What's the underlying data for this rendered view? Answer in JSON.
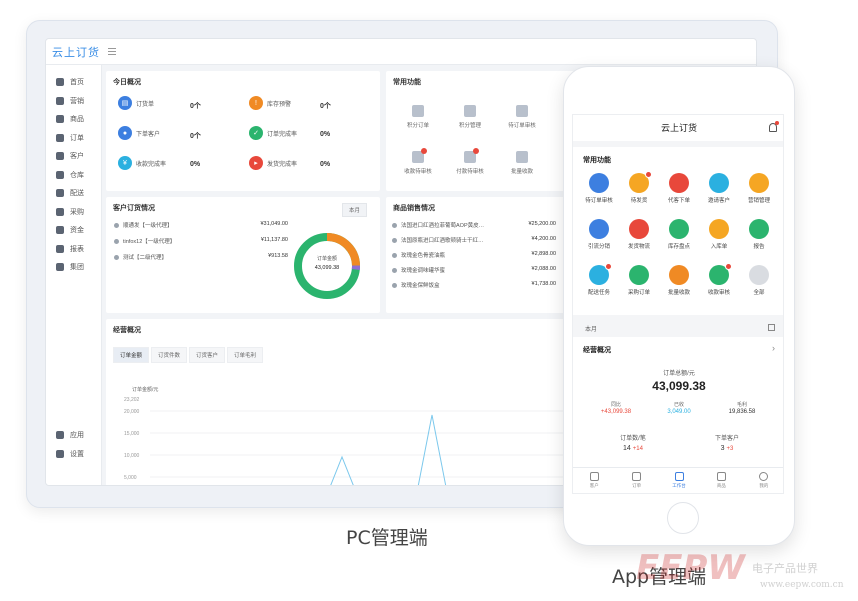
{
  "pc": {
    "brand": "云上订货",
    "sidebar": [
      "首页",
      "营销",
      "商品",
      "订单",
      "客户",
      "仓库",
      "配送",
      "采购",
      "资金",
      "报表",
      "集团"
    ],
    "sidebar_bottom": [
      "应用",
      "设置"
    ],
    "today": {
      "title": "今日概况",
      "stats": [
        {
          "label": "订货单",
          "value": "0个",
          "color": "#3d7fe0"
        },
        {
          "label": "库存预警",
          "value": "0个",
          "color": "#f08a24"
        },
        {
          "label": "下单客户",
          "value": "0个",
          "color": "#3d7fe0"
        },
        {
          "label": "订单完成率",
          "value": "0%",
          "color": "#2bb46e"
        },
        {
          "label": "收款完成率",
          "value": "0%",
          "color": "#2bb0e0"
        },
        {
          "label": "发货完成率",
          "value": "0%",
          "color": "#e8483b"
        }
      ]
    },
    "common": {
      "title": "常用功能",
      "items": [
        "积分订单",
        "积分管理",
        "待订单审核",
        "收款待审核",
        "付款待审核",
        "批量收款"
      ]
    },
    "customer_orders": {
      "title": "客户订货情况",
      "month": "本月",
      "rows": [
        {
          "name": "顺通发【一级代理】",
          "amount": "¥31,049.00"
        },
        {
          "name": "tinfox12【一级代理】",
          "amount": "¥11,137.80"
        },
        {
          "name": "测试【二级代理】",
          "amount": "¥913.58"
        }
      ],
      "donut_label": "订单金额",
      "donut_value": "43,099.38"
    },
    "product_sales": {
      "title": "商品销售情况",
      "rows": [
        {
          "name": "法国进口红酒拉菲葡萄AOP黄皮…",
          "amount": "¥25,200.00"
        },
        {
          "name": "法国原瓶进口红酒歌顿骑士干红…",
          "amount": "¥4,200.00"
        },
        {
          "name": "玫瑰金色骨瓷油瓶",
          "amount": "¥2,898.00"
        },
        {
          "name": "玫瑰金调味罐华蜜",
          "amount": "¥2,088.00"
        },
        {
          "name": "玫瑰金保鲜饭盒",
          "amount": "¥1,738.00"
        }
      ]
    },
    "operations": {
      "title": "经营概况",
      "tabs": [
        "订单金额",
        "订货件数",
        "订货客户",
        "订单毛利"
      ],
      "ylabel": "订单金额/元",
      "yticks": [
        "23,202",
        "20,000",
        "15,000",
        "10,000",
        "5,000"
      ]
    }
  },
  "pc_caption": "PC管理端",
  "app": {
    "title": "云上订货",
    "common_title": "常用功能",
    "apps": [
      {
        "label": "待订单审核",
        "color": "#3d7fe0",
        "badge": false
      },
      {
        "label": "待发货",
        "color": "#f5a623",
        "badge": true
      },
      {
        "label": "代客下单",
        "color": "#e8483b",
        "badge": false
      },
      {
        "label": "邀请客户",
        "color": "#2bb0e0",
        "badge": false
      },
      {
        "label": "营销管理",
        "color": "#f5a623",
        "badge": false
      },
      {
        "label": "引流分销",
        "color": "#3d7fe0",
        "badge": false
      },
      {
        "label": "发货物流",
        "color": "#e8483b",
        "badge": false
      },
      {
        "label": "库存盘点",
        "color": "#2bb46e",
        "badge": false
      },
      {
        "label": "入库单",
        "color": "#f5a623",
        "badge": false
      },
      {
        "label": "报告",
        "color": "#2bb46e",
        "badge": false
      },
      {
        "label": "配送任务",
        "color": "#2bb0e0",
        "badge": true
      },
      {
        "label": "采购订单",
        "color": "#2bb46e",
        "badge": false
      },
      {
        "label": "批量收款",
        "color": "#f08a24",
        "badge": false
      },
      {
        "label": "收款审核",
        "color": "#2bb46e",
        "badge": true
      },
      {
        "label": "全部",
        "color": "#d9dce1",
        "badge": false
      }
    ],
    "month": "本月",
    "overview_title": "经营概况",
    "total_label": "订单总额/元",
    "total_value": "43,099.38",
    "compare": [
      {
        "label": "同比",
        "value": "+43,099.38",
        "color": "#e8483b"
      },
      {
        "label": "已收",
        "value": "3,049.00",
        "color": "#2bb0e0"
      },
      {
        "label": "毛利",
        "value": "19,836.58",
        "color": "#333333"
      }
    ],
    "orders_label": "订单数/笔",
    "orders_value": "14",
    "orders_delta": "+14",
    "customers_label": "下单客户",
    "customers_value": "3",
    "customers_delta": "+3",
    "nav": [
      "客户",
      "订单",
      "工作台",
      "商品",
      "我的"
    ]
  },
  "app_caption": "App管理端",
  "watermark": "EEPW",
  "watermark_cn": "电子产品世界",
  "watermark_url": "www.eepw.com.cn"
}
